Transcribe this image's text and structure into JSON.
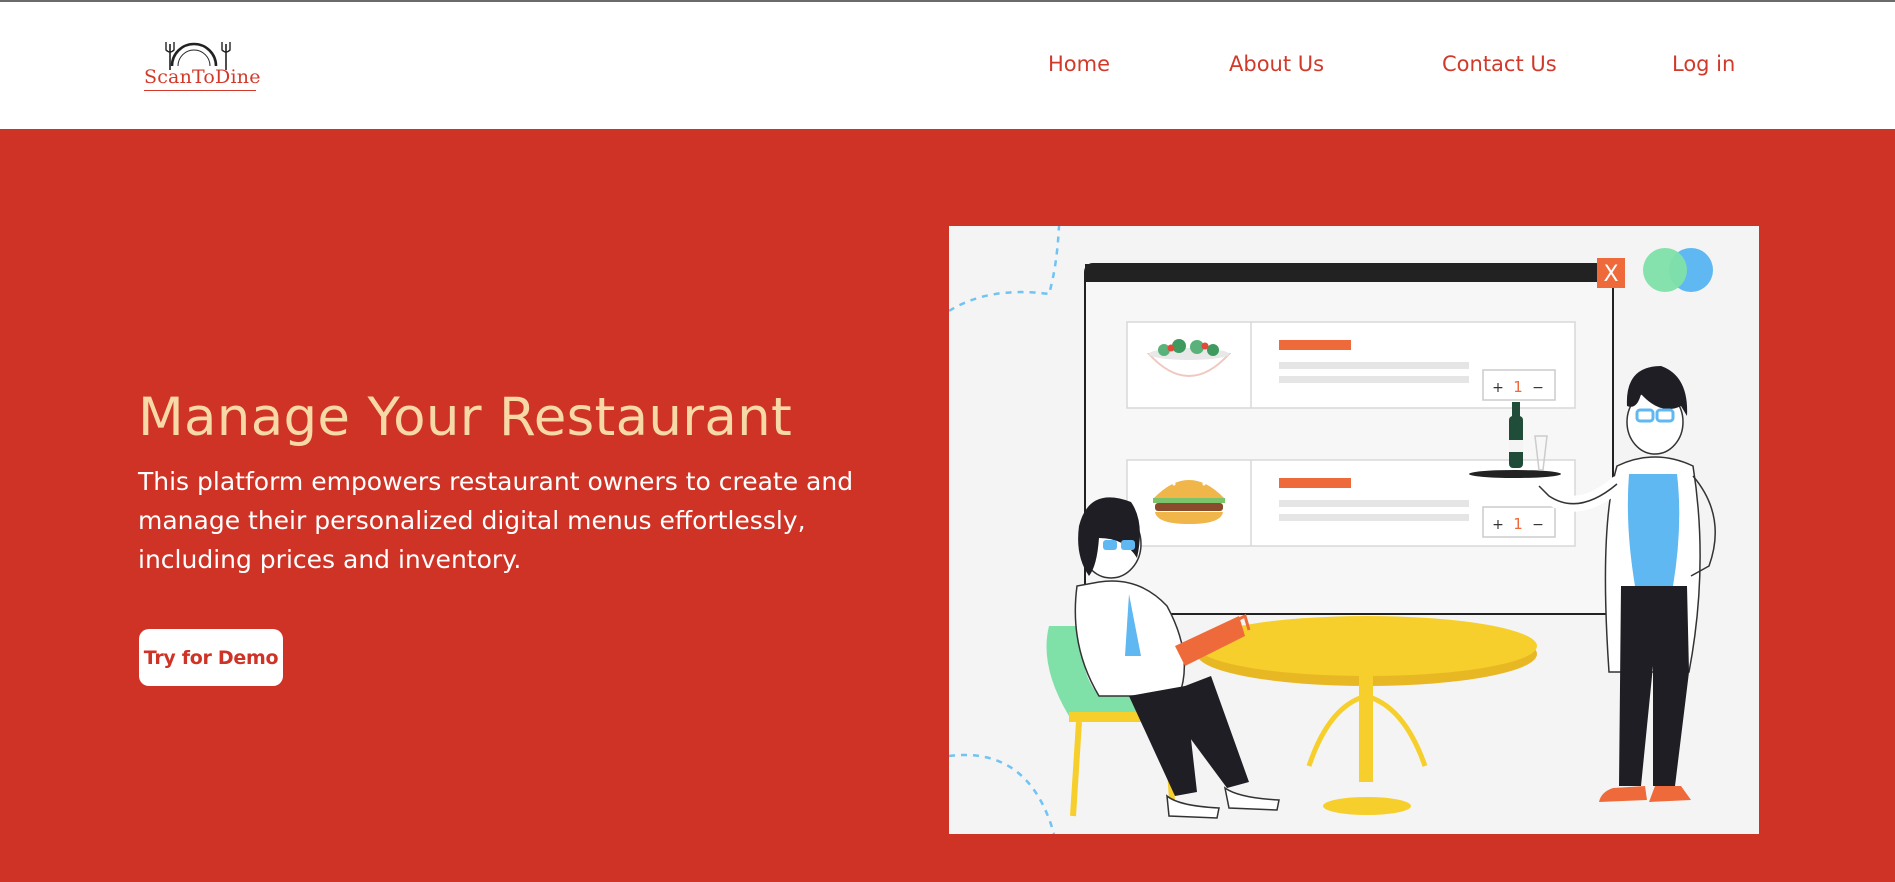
{
  "brand": {
    "logo_text": "ScanToDine",
    "logo_icon": "plate-fork-knife-icon"
  },
  "nav": {
    "items": [
      {
        "label": "Home"
      },
      {
        "label": "About Us"
      },
      {
        "label": "Contact Us"
      },
      {
        "label": "Log in"
      }
    ]
  },
  "hero": {
    "title": "Manage Your Restaurant",
    "description": "This platform empowers restaurant owners to create and manage their personalized digital menus effortlessly, including prices and inventory.",
    "cta_label": "Try for Demo"
  },
  "illustration": {
    "close_glyph": "X",
    "menu_items": [
      {
        "icon": "salad-bowl-icon",
        "quantity": "1",
        "plus": "+",
        "minus": "−"
      },
      {
        "icon": "burger-icon",
        "quantity": "1",
        "plus": "+",
        "minus": "−"
      }
    ]
  },
  "colors": {
    "brand_red": "#cf3326",
    "title_cream": "#f6d9a7",
    "nav_text": "#d13a2b"
  }
}
